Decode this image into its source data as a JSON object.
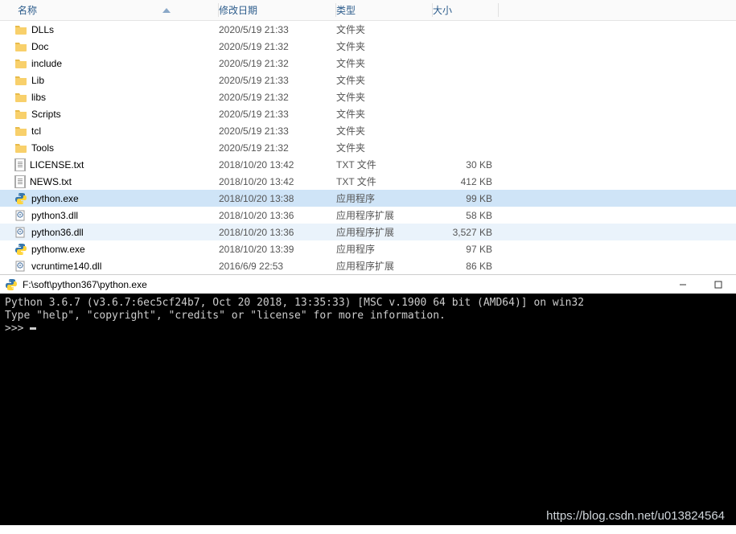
{
  "columns": {
    "name": "名称",
    "date": "修改日期",
    "type": "类型",
    "size": "大小"
  },
  "rows": [
    {
      "icon": "folder",
      "name": "DLLs",
      "date": "2020/5/19 21:33",
      "type": "文件夹",
      "size": "",
      "state": ""
    },
    {
      "icon": "folder",
      "name": "Doc",
      "date": "2020/5/19 21:32",
      "type": "文件夹",
      "size": "",
      "state": ""
    },
    {
      "icon": "folder",
      "name": "include",
      "date": "2020/5/19 21:32",
      "type": "文件夹",
      "size": "",
      "state": ""
    },
    {
      "icon": "folder",
      "name": "Lib",
      "date": "2020/5/19 21:33",
      "type": "文件夹",
      "size": "",
      "state": ""
    },
    {
      "icon": "folder",
      "name": "libs",
      "date": "2020/5/19 21:32",
      "type": "文件夹",
      "size": "",
      "state": ""
    },
    {
      "icon": "folder",
      "name": "Scripts",
      "date": "2020/5/19 21:33",
      "type": "文件夹",
      "size": "",
      "state": ""
    },
    {
      "icon": "folder",
      "name": "tcl",
      "date": "2020/5/19 21:33",
      "type": "文件夹",
      "size": "",
      "state": ""
    },
    {
      "icon": "folder",
      "name": "Tools",
      "date": "2020/5/19 21:32",
      "type": "文件夹",
      "size": "",
      "state": ""
    },
    {
      "icon": "txt",
      "name": "LICENSE.txt",
      "date": "2018/10/20 13:42",
      "type": "TXT 文件",
      "size": "30 KB",
      "state": ""
    },
    {
      "icon": "txt",
      "name": "NEWS.txt",
      "date": "2018/10/20 13:42",
      "type": "TXT 文件",
      "size": "412 KB",
      "state": ""
    },
    {
      "icon": "py",
      "name": "python.exe",
      "date": "2018/10/20 13:38",
      "type": "应用程序",
      "size": "99 KB",
      "state": "selected"
    },
    {
      "icon": "dll",
      "name": "python3.dll",
      "date": "2018/10/20 13:36",
      "type": "应用程序扩展",
      "size": "58 KB",
      "state": ""
    },
    {
      "icon": "dll",
      "name": "python36.dll",
      "date": "2018/10/20 13:36",
      "type": "应用程序扩展",
      "size": "3,527 KB",
      "state": "hover"
    },
    {
      "icon": "py",
      "name": "pythonw.exe",
      "date": "2018/10/20 13:39",
      "type": "应用程序",
      "size": "97 KB",
      "state": ""
    },
    {
      "icon": "dll",
      "name": "vcruntime140.dll",
      "date": "2016/6/9 22:53",
      "type": "应用程序扩展",
      "size": "86 KB",
      "state": ""
    }
  ],
  "terminal": {
    "title": "F:\\soft\\python367\\python.exe",
    "line1": "Python 3.6.7 (v3.6.7:6ec5cf24b7, Oct 20 2018, 13:35:33) [MSC v.1900 64 bit (AMD64)] on win32",
    "line2": "Type \"help\", \"copyright\", \"credits\" or \"license\" for more information.",
    "prompt": ">>> "
  },
  "watermark": "https://blog.csdn.net/u013824564"
}
